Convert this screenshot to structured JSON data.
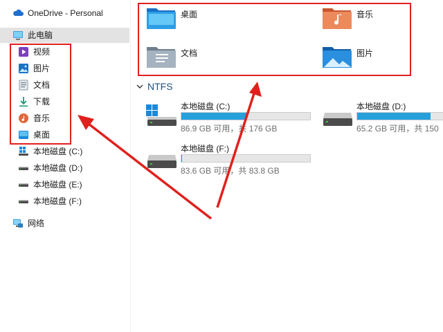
{
  "sidebar": {
    "onedrive_label": "OneDrive - Personal",
    "thispc_label": "此电脑",
    "items": [
      {
        "label": "视频",
        "icon": "video-icon"
      },
      {
        "label": "图片",
        "icon": "pictures-icon"
      },
      {
        "label": "文档",
        "icon": "documents-icon"
      },
      {
        "label": "下载",
        "icon": "downloads-icon"
      },
      {
        "label": "音乐",
        "icon": "music-icon"
      },
      {
        "label": "桌面",
        "icon": "desktop-icon"
      }
    ],
    "drives": [
      {
        "label": "本地磁盘 (C:)",
        "icon": "windows-drive-icon"
      },
      {
        "label": "本地磁盘 (D:)",
        "icon": "drive-icon"
      },
      {
        "label": "本地磁盘 (E:)",
        "icon": "drive-icon"
      },
      {
        "label": "本地磁盘 (F:)",
        "icon": "drive-icon"
      }
    ],
    "network_label": "网络"
  },
  "folders": [
    {
      "label": "桌面",
      "icon": "desktop-folder-icon"
    },
    {
      "label": "音乐",
      "icon": "music-folder-icon"
    },
    {
      "label": "文档",
      "icon": "documents-folder-icon"
    },
    {
      "label": "图片",
      "icon": "pictures-folder-icon"
    }
  ],
  "section": {
    "title": "NTFS"
  },
  "drives": [
    {
      "name": "本地磁盘 (C:)",
      "info": "86.9 GB 可用，共 176 GB",
      "used_fraction": 0.506
    },
    {
      "name": "本地磁盘 (D:)",
      "info": "65.2 GB 可用，共 150",
      "used_fraction": 0.57
    },
    {
      "name": "本地磁盘 (F:)",
      "info": "83.6 GB 可用，共 83.8 GB",
      "used_fraction": 0.003
    }
  ],
  "colors": {
    "accent": "#26a0da",
    "annotation": "#e0201c",
    "selected": "#e3e3e3"
  }
}
